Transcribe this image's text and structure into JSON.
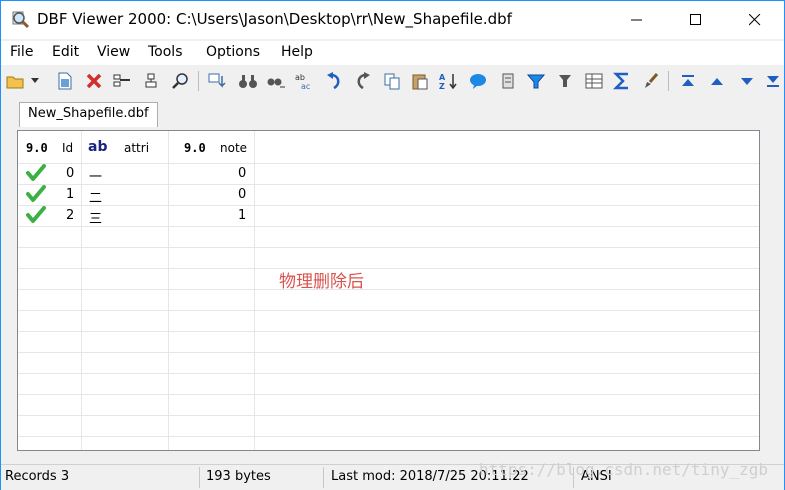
{
  "window": {
    "title": "DBF Viewer 2000: C:\\Users\\Jason\\Desktop\\rr\\New_Shapefile.dbf"
  },
  "menu": [
    "File",
    "Edit",
    "View",
    "Tools",
    "Options",
    "Help"
  ],
  "toolbar": {
    "icons": [
      "open-folder-icon",
      "dropdown-arrow-icon",
      "new-file-icon",
      "delete-icon",
      "struct-icon",
      "struct-edit-icon",
      "zoom-icon",
      "fill-down-icon",
      "binoculars-icon",
      "binoculars-next-icon",
      "replace-icon",
      "undo-icon",
      "redo-icon",
      "copy-icon",
      "paste-icon",
      "sort-az-icon",
      "speech-bubble-icon",
      "filter-icon",
      "filter-clear-icon",
      "pin-icon",
      "table-icon",
      "sum-icon",
      "brush-icon",
      "first-record-icon",
      "prev-record-icon",
      "next-record-icon",
      "last-record-icon"
    ]
  },
  "tab": {
    "label": "New_Shapefile.dbf"
  },
  "grid": {
    "columns": [
      {
        "type_badge": "9.0",
        "name": "Id"
      },
      {
        "type_badge": "ab",
        "name": "attri"
      },
      {
        "type_badge": "9.0",
        "name": "note"
      }
    ],
    "rows": [
      {
        "id": "0",
        "attri": "一",
        "note": "0"
      },
      {
        "id": "1",
        "attri": "二",
        "note": "0"
      },
      {
        "id": "2",
        "attri": "三",
        "note": "1"
      }
    ]
  },
  "annotation": "物理删除后",
  "status": {
    "records": "Records 3",
    "size": "193 bytes",
    "last_mod": "Last mod: 2018/7/25 20:11:22",
    "encoding": "ANSI"
  },
  "watermark": "https://blog.csdn.net/tiny_zgb",
  "colors": {
    "accent_border": "#1e90ff",
    "check_green": "#3cb043",
    "annotation_red": "#d9534f"
  }
}
